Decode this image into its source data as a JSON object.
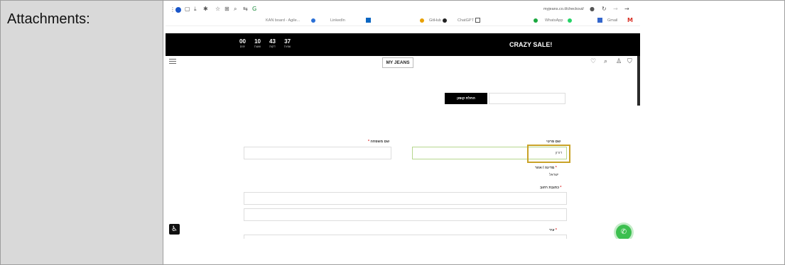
{
  "label": "Attachments:",
  "browser": {
    "url": "myjeans.co.il/checkout/",
    "bookmarks": [
      "Gmail",
      "WhatsApp",
      "ChatGPT",
      "GitHub",
      "LinkedIn",
      "KAN board - Agile..."
    ]
  },
  "banner": {
    "countdown": [
      {
        "value": "00",
        "unit": "ימים"
      },
      {
        "value": "10",
        "unit": "שעות"
      },
      {
        "value": "43",
        "unit": "דקות"
      },
      {
        "value": "37",
        "unit": "שניות"
      }
    ],
    "sale_label": "CRAZY SALE!"
  },
  "store": {
    "logo": "MY JEANS"
  },
  "form": {
    "coupon_button": "החלת קופון",
    "first_name_label": "שם פרטי",
    "last_name_label": "שם משפחה",
    "first_name_value": "דורון",
    "country_label": "מדינה / אזור",
    "country_value": "ישראל",
    "street_label": "כתובת רחוב",
    "city_label": "עיר"
  },
  "colors": {
    "banner": "#000000",
    "highlight": "#c9a227",
    "whatsapp": "#3cbf4f"
  }
}
